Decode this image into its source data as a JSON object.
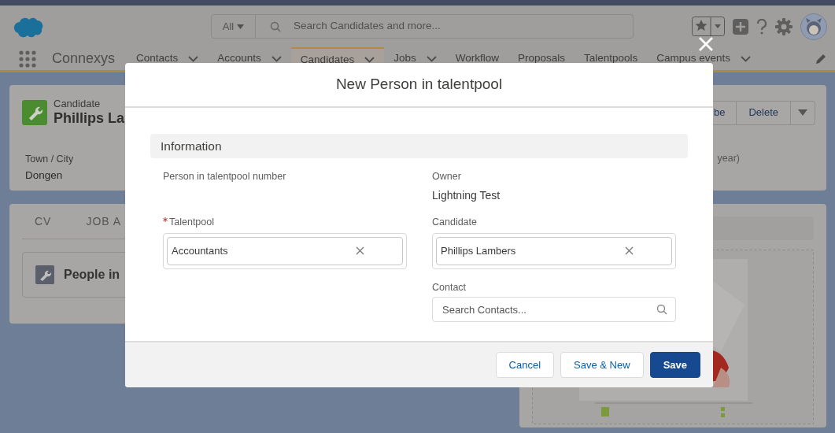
{
  "header": {
    "search_scope": "All",
    "search_placeholder": "Search Candidates and more...",
    "app_name": "Connexys",
    "nav_items": [
      {
        "label": "Contacts",
        "has_menu": true,
        "selected": false
      },
      {
        "label": "Accounts",
        "has_menu": true,
        "selected": false
      },
      {
        "label": "Candidates",
        "has_menu": true,
        "selected": true
      },
      {
        "label": "Jobs",
        "has_menu": true,
        "selected": false
      },
      {
        "label": "Workflow",
        "has_menu": false,
        "selected": false
      },
      {
        "label": "Proposals",
        "has_menu": false,
        "selected": false
      },
      {
        "label": "Talentpools",
        "has_menu": false,
        "selected": false
      },
      {
        "label": "Campus events",
        "has_menu": true,
        "selected": false
      }
    ]
  },
  "record": {
    "type_label": "Candidate",
    "name": "Phillips La",
    "buttons": [
      "be",
      "Delete"
    ],
    "fields": [
      {
        "label": "Town / City",
        "value": "Dongen"
      }
    ],
    "cut_text": "year)"
  },
  "tabs": [
    {
      "label": "CV"
    },
    {
      "label": "JOB A"
    }
  ],
  "related_card": {
    "title": "People in"
  },
  "modal": {
    "title": "New Person in talentpool",
    "section": "Information",
    "fields": [
      {
        "kind": "readonly",
        "label": "Person in talentpool number"
      },
      {
        "kind": "static",
        "label": "Owner",
        "value": "Lightning Test"
      },
      {
        "kind": "lookup",
        "label": "Talentpool",
        "required": true,
        "value": "Accountants"
      },
      {
        "kind": "lookup",
        "label": "Candidate",
        "required": false,
        "value": "Phillips Lambers"
      },
      {
        "kind": "spacer"
      },
      {
        "kind": "search",
        "label": "Contact",
        "placeholder": "Search Contacts..."
      }
    ],
    "buttons": [
      {
        "label": "Cancel",
        "kind": "neutral"
      },
      {
        "label": "Save & New",
        "kind": "neutral"
      },
      {
        "label": "Save",
        "kind": "brand"
      }
    ]
  }
}
